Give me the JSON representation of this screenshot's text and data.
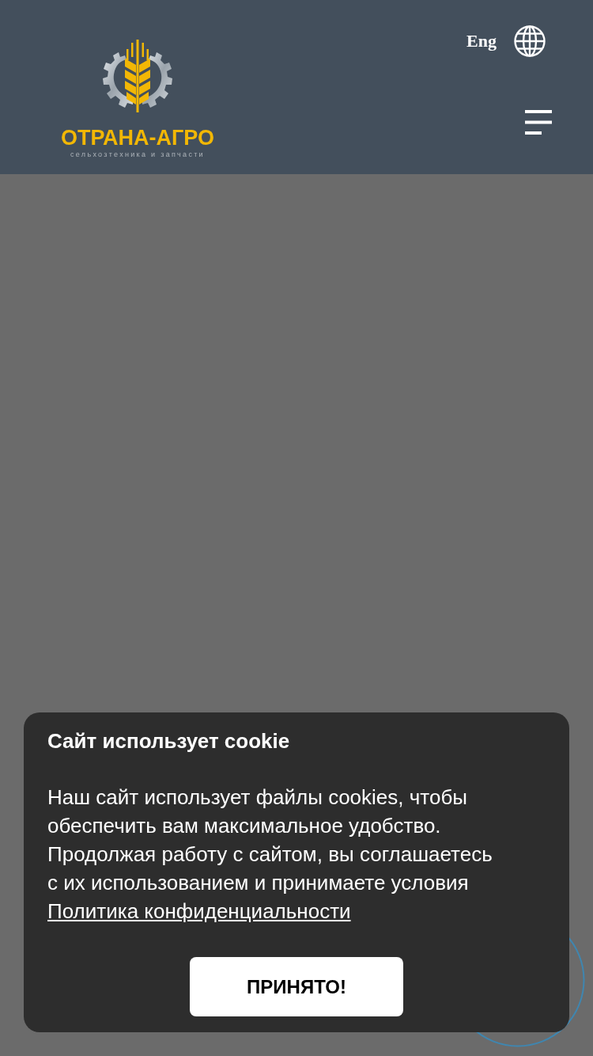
{
  "header": {
    "logo": {
      "title": "ОТРАНА-АГРО",
      "subtitle": "сельхозтехника и запчасти"
    },
    "language": "Eng"
  },
  "cookie_banner": {
    "title": "Сайт использует cookie",
    "text": "Наш сайт использует файлы cookies, чтобы обеспечить вам максимальное удобство. Продолжая работу с сайтом, вы соглашаетесь с их использованием и принимаете условия",
    "link": "Политика конфиденциальности",
    "button": "ПРИНЯТО!"
  }
}
